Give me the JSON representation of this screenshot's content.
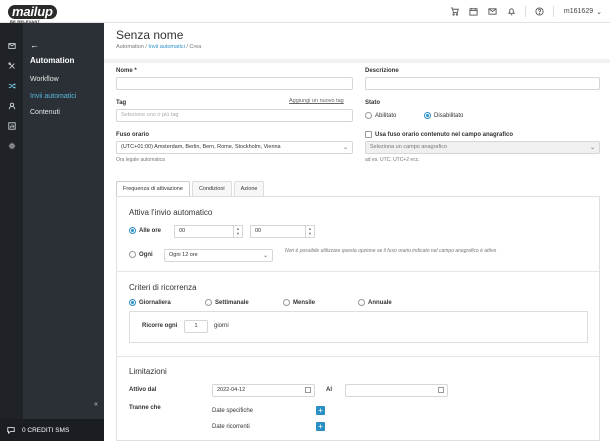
{
  "header": {
    "logo_text": "mailup",
    "logo_tagline": "BE RELEVANT",
    "user": "m161629",
    "icons": [
      "cart-icon",
      "calendar-icon",
      "mail-icon",
      "bell-icon",
      "help-icon"
    ]
  },
  "rail": {
    "icons": [
      "mail-icon",
      "tools-icon",
      "shuffle-icon",
      "contacts-icon",
      "chart-icon",
      "settings-icon"
    ],
    "active_index": 2
  },
  "sidebar": {
    "back": "←",
    "title": "Automation",
    "items": [
      {
        "label": "Workflow",
        "active": false
      },
      {
        "label": "Invii automatici",
        "active": true
      },
      {
        "label": "Contenuti",
        "active": false
      }
    ],
    "collapse": "«"
  },
  "footer": {
    "credits": "0 CREDITI SMS"
  },
  "page": {
    "title": "Senza nome",
    "breadcrumb": [
      "Automation",
      "Invii automatici",
      "Crea"
    ]
  },
  "form": {
    "name_label": "Nome *",
    "name_value": "",
    "description_label": "Descrizione",
    "description_value": "",
    "tag_label": "Tag",
    "tag_placeholder": "Selezione uno o più tag",
    "tag_add_link": "Aggiungi un nuovo tag",
    "status_label": "Stato",
    "status_options": [
      "Abilitato",
      "Disabilitato"
    ],
    "status_selected": "Disabilitato",
    "timezone_label": "Fuso orario",
    "timezone_value": "(UTC+01:00) Amsterdam, Berlin, Bern, Rome, Stockholm, Vienna",
    "timezone_help": "Ora legale automatica",
    "timezone_field_checkbox": "Usa fuso orario contenuto nel campo anagrafico",
    "timezone_field_placeholder": "Seleziona un campo anagrafico",
    "timezone_field_help": "ad es. UTC, UTC+2 ecc."
  },
  "tabs": [
    {
      "label": "Frequenza di attivazione",
      "active": true
    },
    {
      "label": "Condizioni",
      "active": false
    },
    {
      "label": "Azione",
      "active": false
    }
  ],
  "activation": {
    "title": "Attiva l'invio automatico",
    "at_label": "Alle ore",
    "hour": "00",
    "minute": "00",
    "every_label": "Ogni",
    "every_value": "Ogni 12 ore",
    "note": "Non è possibile utilizzare questa opzione se il fuso orario indicato nel campo anagrafico è attivo"
  },
  "recurrence": {
    "title": "Criteri di ricorrenza",
    "options": [
      "Giornaliera",
      "Settimanale",
      "Mensile",
      "Annuale"
    ],
    "selected": "Giornaliera",
    "repeat_label": "Ricorre ogni",
    "repeat_value": "1",
    "repeat_unit": "giorni"
  },
  "limits": {
    "title": "Limitazioni",
    "from_label": "Attivo dal",
    "from_value": "2022-04-12",
    "to_label": "Al",
    "to_value": "",
    "except_label": "Tranne che",
    "specific_dates": "Date specifiche",
    "recurring_dates": "Date ricorrenti"
  }
}
